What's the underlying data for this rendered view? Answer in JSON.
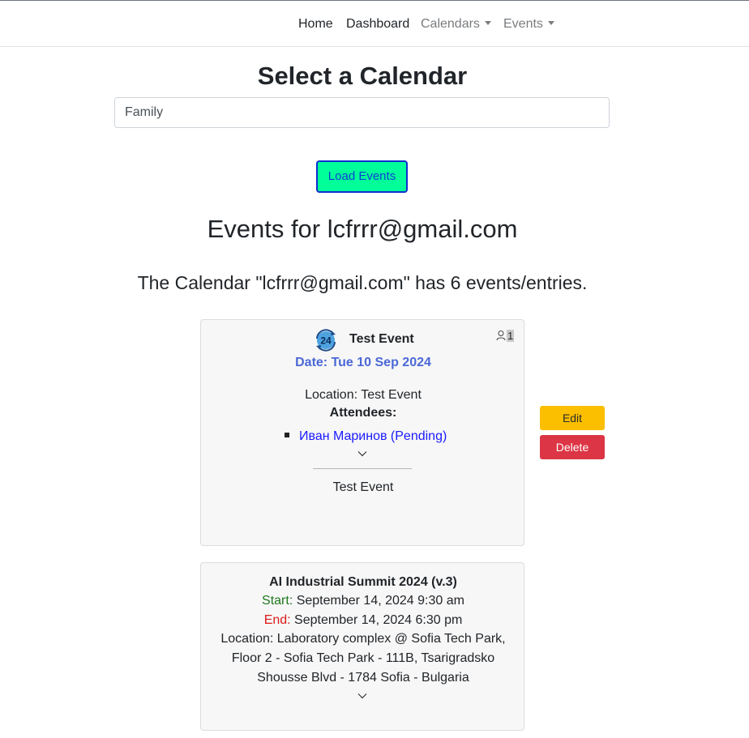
{
  "nav": {
    "home": "Home",
    "dashboard": "Dashboard",
    "calendars": "Calendars",
    "events": "Events"
  },
  "page": {
    "title": "Select a Calendar",
    "selected_calendar": "Family",
    "load_button": "Load Events",
    "events_heading": "Events for lcfrrr@gmail.com",
    "count_heading": "The Calendar \"lcfrrr@gmail.com\" has 6 events/entries."
  },
  "events": [
    {
      "icon_badge": "24",
      "title": "Test Event",
      "attendee_count": "1",
      "date": "Date: Tue 10 Sep 2024",
      "location": "Location: Test Event",
      "attendees_label": "Attendees:",
      "attendees": [
        "Иван Маринов (Pending)"
      ],
      "description": "Test Event",
      "edit_label": "Edit",
      "delete_label": "Delete"
    },
    {
      "title": "AI Industrial Summit 2024 (v.3)",
      "start_label": "Start:",
      "start_value": " September 14, 2024 9:30 am",
      "end_label": "End:",
      "end_value": " September 14, 2024 6:30 pm",
      "location": "Location: Laboratory complex @ Sofia Tech Park, Floor 2 - Sofia Tech Park - 111B, Tsarigradsko Shousse Blvd - 1784 Sofia - Bulgaria"
    }
  ],
  "colors": {
    "load_button_bg": "#00ff99",
    "edit_button_bg": "#fcbf00",
    "delete_button_bg": "#dc3545",
    "date_text": "#4a68d6",
    "attendee_link": "#1a1aff"
  }
}
